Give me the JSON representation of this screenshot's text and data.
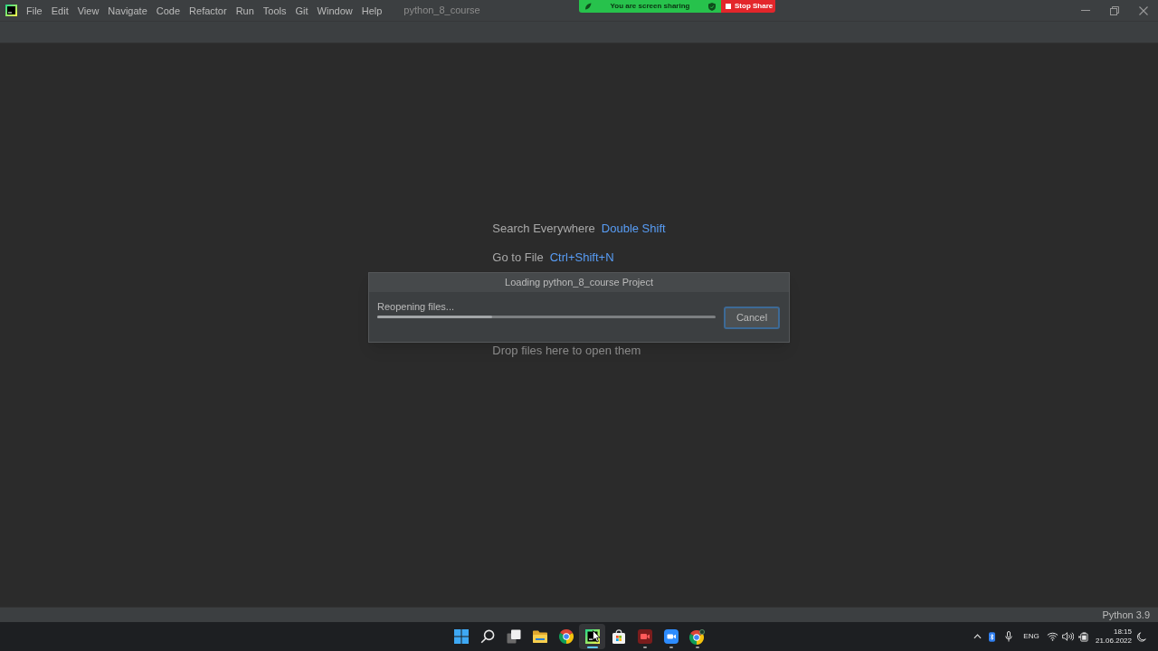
{
  "window": {
    "title": "python_8_course",
    "menu": [
      "File",
      "Edit",
      "View",
      "Navigate",
      "Code",
      "Refactor",
      "Run",
      "Tools",
      "Git",
      "Window",
      "Help"
    ]
  },
  "screen_share": {
    "status": "You are screen sharing",
    "stop_button": "Stop Share"
  },
  "hints": [
    {
      "label": "Search Everywhere",
      "shortcut": "Double Shift"
    },
    {
      "label": "Go to File",
      "shortcut": "Ctrl+Shift+N"
    }
  ],
  "drop_hint": "Drop files here to open them",
  "dialog": {
    "title": "Loading python_8_course Project",
    "message": "Reopening files...",
    "progress": {
      "level": 0.34
    },
    "cancel_button": "Cancel"
  },
  "status_bar": {
    "interpreter": "Python 3.9"
  },
  "taskbar": {
    "apps": [
      {
        "selected": false,
        "running": false
      },
      {
        "selected": false,
        "running": false
      },
      {
        "selected": true,
        "running": true
      },
      {
        "selected": false,
        "running": false
      },
      {
        "selected": false,
        "running": true
      },
      {
        "selected": false,
        "running": true
      },
      {
        "selected": false,
        "running": true
      }
    ],
    "tray": {
      "language": "ENG",
      "time": "18:15",
      "date": "21.06.2022"
    }
  }
}
